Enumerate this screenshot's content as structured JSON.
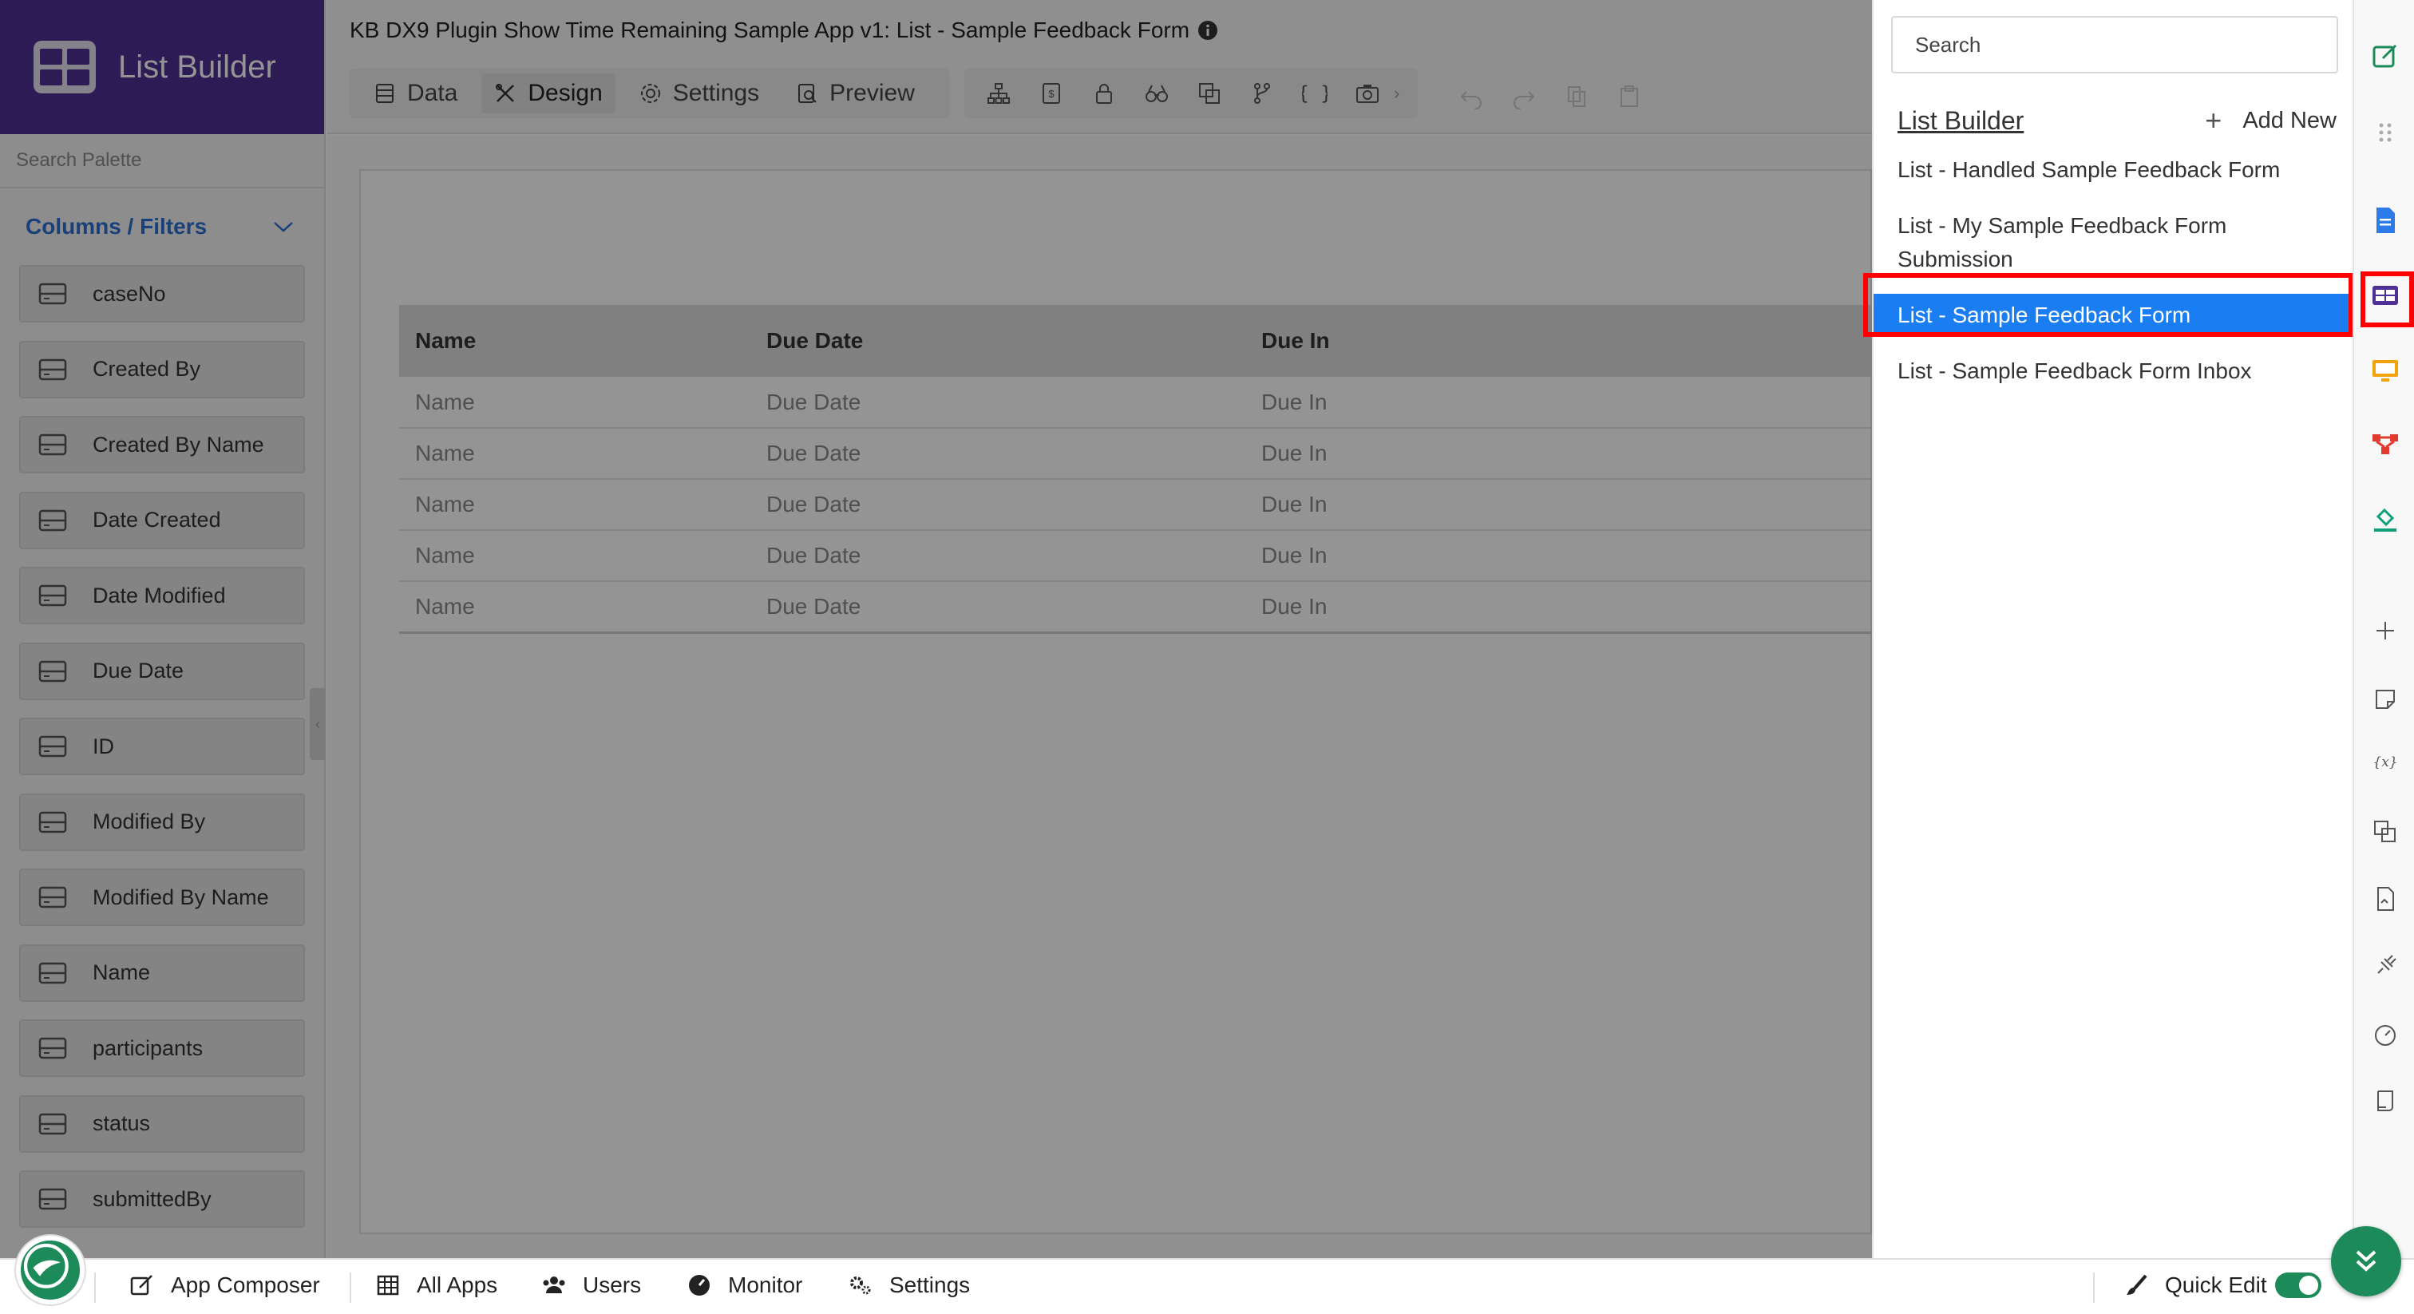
{
  "palette": {
    "brand_title": "List Builder",
    "search_placeholder": "Search Palette",
    "section_title": "Columns / Filters",
    "fields": [
      "caseNo",
      "Created By",
      "Created By Name",
      "Date Created",
      "Date Modified",
      "Due Date",
      "ID",
      "Modified By",
      "Modified By Name",
      "Name",
      "participants",
      "status",
      "submittedBy"
    ]
  },
  "header": {
    "app_title": "KB DX9 Plugin Show Time Remaining Sample App v1: List - Sample Feedback Form",
    "tabs": [
      {
        "label": "Data",
        "icon": "data-icon"
      },
      {
        "label": "Design",
        "icon": "design-icon",
        "active": true
      },
      {
        "label": "Settings",
        "icon": "gear-icon"
      },
      {
        "label": "Preview",
        "icon": "preview-icon"
      }
    ]
  },
  "table": {
    "headers": [
      "Name",
      "Due Date",
      "Due In"
    ],
    "rows": [
      [
        "Name",
        "Due Date",
        "Due In"
      ],
      [
        "Name",
        "Due Date",
        "Due In"
      ],
      [
        "Name",
        "Due Date",
        "Due In"
      ],
      [
        "Name",
        "Due Date",
        "Due In"
      ],
      [
        "Name",
        "Due Date",
        "Due In"
      ]
    ]
  },
  "dropdown": {
    "search_placeholder": "Search",
    "title": "List Builder",
    "add_new_label": "Add New",
    "items": [
      {
        "label": "List - Handled Sample Feedback Form"
      },
      {
        "label": "List - My Sample Feedback Form Submission"
      },
      {
        "label": "List - Sample Feedback Form",
        "selected": true
      },
      {
        "label": "List - Sample Feedback Form Inbox"
      }
    ]
  },
  "bottom_bar": {
    "app_composer": "App Composer",
    "all_apps": "All Apps",
    "users": "Users",
    "monitor": "Monitor",
    "settings": "Settings",
    "quick_edit": "Quick Edit",
    "quick_edit_enabled": true
  },
  "colors": {
    "brand": "#4e2f95",
    "selected": "#1a7ef2",
    "highlight": "#ff0000",
    "accent_green": "#1d8a5a",
    "link_blue": "#2d6fd1"
  }
}
